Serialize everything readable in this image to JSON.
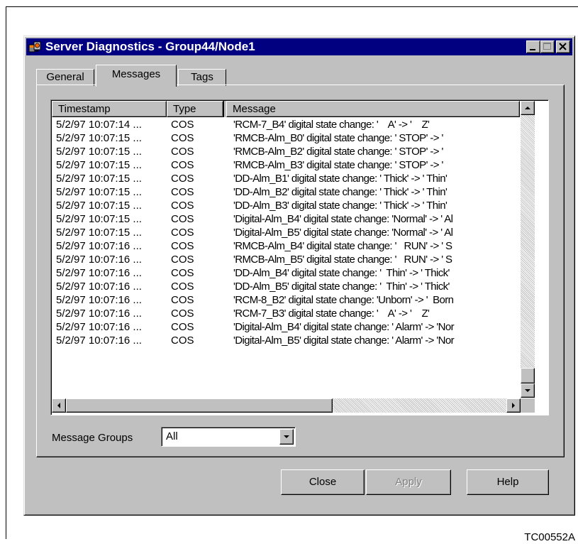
{
  "window": {
    "title": "Server Diagnostics - Group44/Node1",
    "icon": "server-diagnostics-icon"
  },
  "tabs": [
    {
      "label": "General",
      "active": false
    },
    {
      "label": "Messages",
      "active": true
    },
    {
      "label": "Tags",
      "active": false
    }
  ],
  "table": {
    "columns": [
      "Timestamp",
      "Type",
      "Message"
    ],
    "rows": [
      {
        "timestamp": "5/2/97 10:07:14 ...",
        "type": "COS",
        "message": "'RCM-7_B4' digital state change: '    A' -> '    Z'"
      },
      {
        "timestamp": "5/2/97 10:07:15 ...",
        "type": "COS",
        "message": "'RMCB-Alm_B0' digital state change: ' STOP' -> '"
      },
      {
        "timestamp": "5/2/97 10:07:15 ...",
        "type": "COS",
        "message": "'RMCB-Alm_B2' digital state change: ' STOP' -> '"
      },
      {
        "timestamp": "5/2/97 10:07:15 ...",
        "type": "COS",
        "message": "'RMCB-Alm_B3' digital state change: ' STOP' -> '"
      },
      {
        "timestamp": "5/2/97 10:07:15 ...",
        "type": "COS",
        "message": "'DD-Alm_B1' digital state change: ' Thick' -> ' Thin'"
      },
      {
        "timestamp": "5/2/97 10:07:15 ...",
        "type": "COS",
        "message": "'DD-Alm_B2' digital state change: ' Thick' -> ' Thin'"
      },
      {
        "timestamp": "5/2/97 10:07:15 ...",
        "type": "COS",
        "message": "'DD-Alm_B3' digital state change: ' Thick' -> ' Thin'"
      },
      {
        "timestamp": "5/2/97 10:07:15 ...",
        "type": "COS",
        "message": "'Digital-Alm_B4' digital state change: 'Normal' -> ' Al"
      },
      {
        "timestamp": "5/2/97 10:07:15 ...",
        "type": "COS",
        "message": "'Digital-Alm_B5' digital state change: 'Normal' -> ' Al"
      },
      {
        "timestamp": "5/2/97 10:07:16 ...",
        "type": "COS",
        "message": "'RMCB-Alm_B4' digital state change: '   RUN' -> ' S"
      },
      {
        "timestamp": "5/2/97 10:07:16 ...",
        "type": "COS",
        "message": "'RMCB-Alm_B5' digital state change: '   RUN' -> ' S"
      },
      {
        "timestamp": "5/2/97 10:07:16 ...",
        "type": "COS",
        "message": "'DD-Alm_B4' digital state change: '  Thin' -> ' Thick'"
      },
      {
        "timestamp": "5/2/97 10:07:16 ...",
        "type": "COS",
        "message": "'DD-Alm_B5' digital state change: '  Thin' -> ' Thick'"
      },
      {
        "timestamp": "5/2/97 10:07:16 ...",
        "type": "COS",
        "message": "'RCM-8_B2' digital state change: 'Unborn' -> '  Born"
      },
      {
        "timestamp": "5/2/97 10:07:16 ...",
        "type": "COS",
        "message": "'RCM-7_B3' digital state change: '    A' -> '    Z'"
      },
      {
        "timestamp": "5/2/97 10:07:16 ...",
        "type": "COS",
        "message": "'Digital-Alm_B4' digital state change: ' Alarm' -> 'Nor"
      },
      {
        "timestamp": "5/2/97 10:07:16 ...",
        "type": "COS",
        "message": "'Digital-Alm_B5' digital state change: ' Alarm' -> 'Nor"
      }
    ]
  },
  "message_groups": {
    "label": "Message Groups",
    "selected": "All"
  },
  "buttons": {
    "close": "Close",
    "apply": "Apply",
    "help": "Help"
  },
  "figure_id": "TC00552A",
  "colors": {
    "face": "#c0c0c0",
    "title_bar": "#000080",
    "disabled_text": "#808080"
  }
}
